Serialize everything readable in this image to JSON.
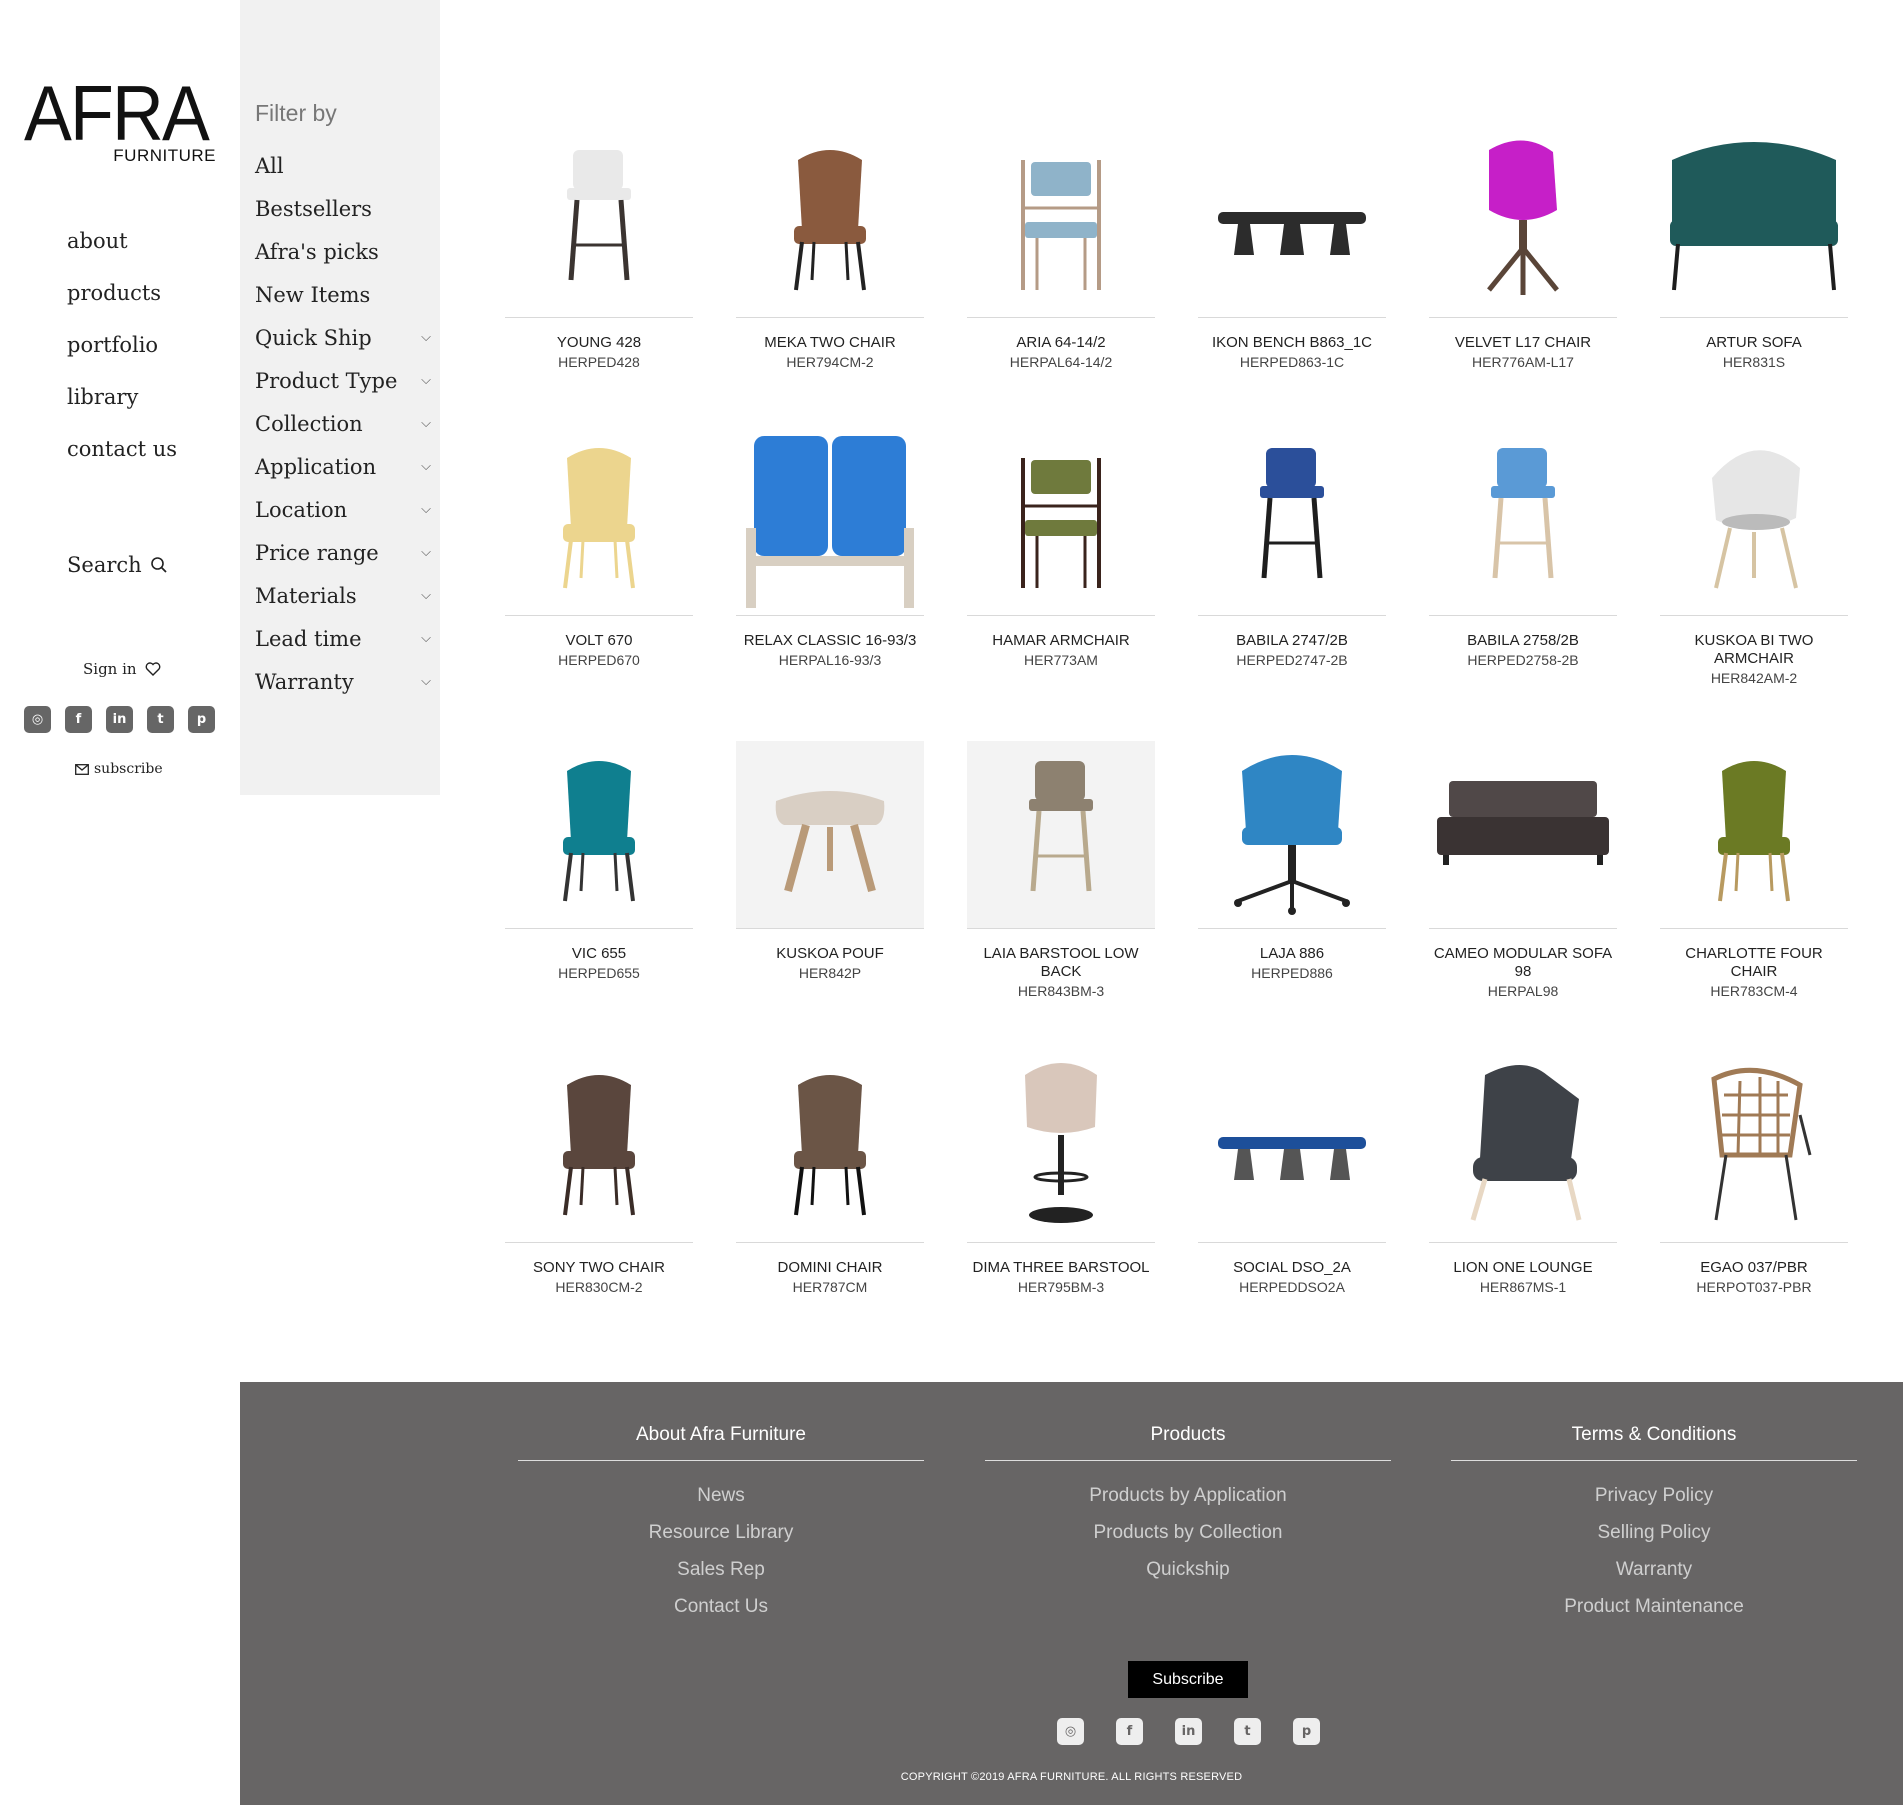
{
  "brand": {
    "logo_word": "AFRA",
    "logo_sub": "FURNITURE"
  },
  "nav": {
    "items": [
      {
        "label": "about"
      },
      {
        "label": "products"
      },
      {
        "label": "portfolio"
      },
      {
        "label": "library"
      },
      {
        "label": "contact us"
      }
    ],
    "search_label": "Search",
    "signin_label": "Sign in",
    "subscribe_label": "subscribe"
  },
  "filter": {
    "heading": "Filter by",
    "items": [
      {
        "label": "All",
        "icon": ""
      },
      {
        "label": "Bestsellers",
        "icon": ""
      },
      {
        "label": "Afra's picks",
        "icon": ""
      },
      {
        "label": "New Items",
        "icon": ""
      },
      {
        "label": "Quick Ship",
        "icon": "⌵"
      },
      {
        "label": "Product Type",
        "icon": "⌵"
      },
      {
        "label": "Collection",
        "icon": "⌵"
      },
      {
        "label": "Application",
        "icon": "⌵"
      },
      {
        "label": "Location",
        "icon": "⌵"
      },
      {
        "label": "Price range",
        "icon": "⌵"
      },
      {
        "label": "Materials",
        "icon": "⌵"
      },
      {
        "label": "Lead time",
        "icon": "⌵"
      },
      {
        "label": "Warranty",
        "icon": "⌵"
      }
    ]
  },
  "products": [
    {
      "name": "YOUNG 428",
      "code": "HERPED428",
      "icon": "barstool-icon"
    },
    {
      "name": "MEKA TWO CHAIR",
      "code": "HER794CM-2",
      "icon": "chair-icon"
    },
    {
      "name": "ARIA 64-14/2",
      "code": "HERPAL64-14/2",
      "icon": "armchair-icon"
    },
    {
      "name": "IKON BENCH B863_1C",
      "code": "HERPED863-1C",
      "icon": "bench-icon"
    },
    {
      "name": "VELVET L17 CHAIR",
      "code": "HER776AM-L17",
      "icon": "swivel-chair-icon"
    },
    {
      "name": "ARTUR SOFA",
      "code": "HER831S",
      "icon": "sofa-icon"
    },
    {
      "name": "VOLT 670",
      "code": "HERPED670",
      "icon": "chair-icon"
    },
    {
      "name": "RELAX CLASSIC 16-93/3",
      "code": "HERPAL16-93/3",
      "icon": "loveseat-icon"
    },
    {
      "name": "HAMAR ARMCHAIR",
      "code": "HER773AM",
      "icon": "armchair-icon"
    },
    {
      "name": "BABILA 2747/2B",
      "code": "HERPED2747-2B",
      "icon": "barstool-icon"
    },
    {
      "name": "BABILA 2758/2B",
      "code": "HERPED2758-2B",
      "icon": "barstool-icon"
    },
    {
      "name": "KUSKOA BI TWO ARMCHAIR",
      "code": "HER842AM-2",
      "icon": "shell-chair-icon"
    },
    {
      "name": "VIC 655",
      "code": "HERPED655",
      "icon": "chair-icon"
    },
    {
      "name": "KUSKOA POUF",
      "code": "HER842P",
      "icon": "pouf-icon"
    },
    {
      "name": "LAIA BARSTOOL LOW BACK",
      "code": "HER843BM-3",
      "icon": "barstool-icon"
    },
    {
      "name": "LAJA 886",
      "code": "HERPED886",
      "icon": "office-chair-icon"
    },
    {
      "name": "CAMEO MODULAR SOFA 98",
      "code": "HERPAL98",
      "icon": "modular-sofa-icon"
    },
    {
      "name": "CHARLOTTE FOUR CHAIR",
      "code": "HER783CM-4",
      "icon": "chair-icon"
    },
    {
      "name": "SONY TWO CHAIR",
      "code": "HER830CM-2",
      "icon": "chair-icon"
    },
    {
      "name": "DOMINI CHAIR",
      "code": "HER787CM",
      "icon": "chair-icon"
    },
    {
      "name": "DIMA THREE BARSTOOL",
      "code": "HER795BM-3",
      "icon": "pedestal-stool-icon"
    },
    {
      "name": "SOCIAL DSO_2A",
      "code": "HERPEDDSO2A",
      "icon": "bench-icon"
    },
    {
      "name": "LION ONE LOUNGE",
      "code": "HER867MS-1",
      "icon": "lounge-chair-icon"
    },
    {
      "name": "EGAO 037/PBR",
      "code": "HERPOT037-PBR",
      "icon": "wicker-chair-icon"
    }
  ],
  "footer": {
    "columns": [
      {
        "title": "About Afra Furniture",
        "links": [
          "News",
          "Resource Library",
          "Sales Rep",
          "Contact Us"
        ]
      },
      {
        "title": "Products",
        "links": [
          "Products by Application",
          "Products by Collection",
          "Quickship"
        ]
      },
      {
        "title": "Terms & Conditions",
        "links": [
          "Privacy Policy",
          "Selling Policy",
          "Warranty",
          "Product Maintenance"
        ]
      }
    ],
    "subscribe_label": "Subscribe",
    "copyright": "COPYRIGHT ©2019 AFRA FURNITURE. ALL RIGHTS RESERVED"
  },
  "social": [
    "instagram-icon",
    "facebook-icon",
    "linkedin-icon",
    "twitter-icon",
    "pinterest-icon"
  ],
  "colors": {
    "footer_bg": "#676565",
    "filter_bg": "#f1f1f1",
    "subscribe_button": "#000000"
  }
}
